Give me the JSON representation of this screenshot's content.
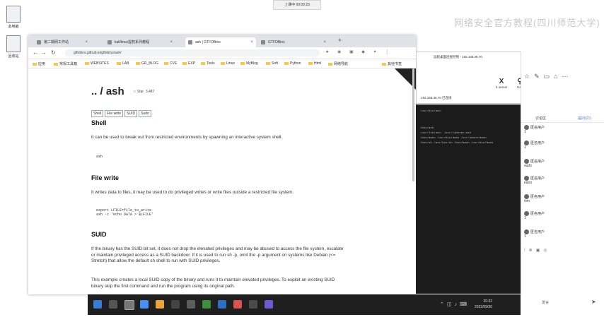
{
  "desktop": {
    "icons": [
      "此电脑",
      "回收站"
    ],
    "meeting_pill": "上课中 00:09:23",
    "watermark": "网络安全官方教程(四川师范大学)"
  },
  "browser": {
    "tabs": [
      {
        "label": "第二期网工作站"
      },
      {
        "label": "kali/linux提权系列教程"
      },
      {
        "label": "ash | GTFOBins"
      },
      {
        "label": "GTFOBins"
      }
    ],
    "url": "gtfobins.github.io/gtfobins/ash/",
    "bookmarks": [
      "应用",
      "常规工具箱",
      "WEBSITES",
      "LAB",
      "GR_BLOG",
      "CVE",
      "EXP",
      "Tools",
      "Linux",
      "MyBlog",
      "Soft",
      "Python",
      "Html",
      "网络导航",
      "其他书签"
    ]
  },
  "page": {
    "title": ".. / ash",
    "star_label": "Star",
    "star_count": "3,487",
    "pills": [
      "Shell",
      "File write",
      "SUID",
      "Sudo"
    ],
    "shell_heading": "Shell",
    "shell_text": "It can be used to break out from restricted environments by spawning an interactive system shell.",
    "shell_code": "ash",
    "filewrite_heading": "File write",
    "filewrite_text": "It writes data to files, it may be used to do privileged writes or write files outside a restricted file system.",
    "filewrite_code": "export LFILE=file_to_write\nash -c 'echo DATA > $LFILE'",
    "suid_heading": "SUID",
    "suid_text1": "If the binary has the SUID bit set, it does not drop the elevated privileges and may be abused to access the file system, escalate or maintain privileged access as a SUID backdoor. If it is used to run sh -p, omit the -p argument on systems like Debian (<= Stretch) that allow the default sh shell to run with SUID privileges.",
    "suid_text2": "This example creates a local SUID copy of the binary and runs it to maintain elevated privileges. To exploit an existing SUID binary skip the first command and run the program using its original path."
  },
  "remote": {
    "title": "远程桌面连接控制 - 192.168.38.70",
    "status": "192.168.38.70 已连接",
    "buttons": [
      "X server",
      "Kali"
    ]
  },
  "terminal": {
    "lines": [
      "/usr/bin/ash:",
      "/bin/ash",
      "/usr/lib/ash: /usr/libexec/ash",
      "/bin/dash /usr/bin/dash /usr/share/dash",
      "/bin/sh /usr/bin/sh /bin/bash /usr/bin/bash"
    ]
  },
  "chat": {
    "tab_left": "讨论区",
    "tab_right": "提问(21)",
    "messages": [
      {
        "user": "匿名用户",
        "text": "1"
      },
      {
        "user": "匿名用户",
        "text": "1"
      },
      {
        "user": "匿名用户",
        "text": "sudo"
      },
      {
        "user": "匿名用户",
        "text": "nano"
      },
      {
        "user": "匿名用户",
        "text": "vim"
      },
      {
        "user": "匿名用户",
        "text": "1"
      },
      {
        "user": "匿名用户",
        "text": "1"
      }
    ],
    "footer": "发言"
  },
  "taskbar": {
    "time": "20:32",
    "date": "2022/09/30"
  }
}
